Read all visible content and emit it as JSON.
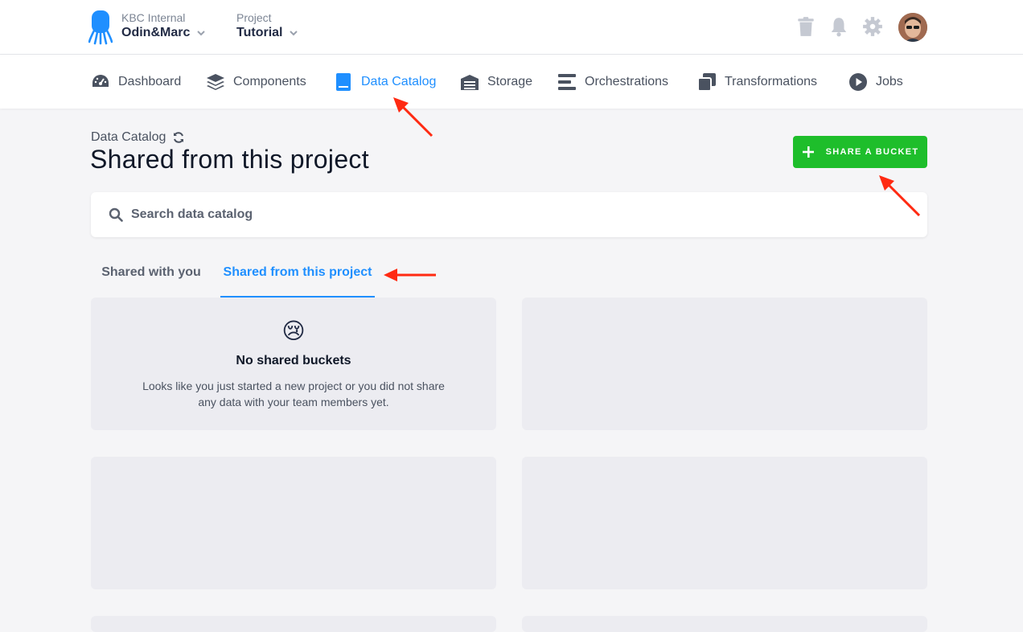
{
  "topbar": {
    "org_label": "KBC Internal",
    "org_name": "Odin&Marc",
    "project_label": "Project",
    "project_name": "Tutorial",
    "icons": [
      "logo-icon",
      "trash-icon",
      "bell-icon",
      "gear-icon",
      "avatar"
    ]
  },
  "nav": {
    "items": [
      {
        "label": "Dashboard",
        "icon": "dashboard-icon"
      },
      {
        "label": "Components",
        "icon": "layers-icon"
      },
      {
        "label": "Data Catalog",
        "icon": "book-icon",
        "active": true
      },
      {
        "label": "Storage",
        "icon": "warehouse-icon"
      },
      {
        "label": "Orchestrations",
        "icon": "bars-icon"
      },
      {
        "label": "Transformations",
        "icon": "copy-icon"
      },
      {
        "label": "Jobs",
        "icon": "play-icon"
      }
    ]
  },
  "page": {
    "breadcrumb": "Data Catalog",
    "title": "Shared from this project",
    "share_button": "SHARE A BUCKET"
  },
  "search": {
    "placeholder": "Search data catalog",
    "value": ""
  },
  "tabs": [
    {
      "label": "Shared with you",
      "active": false
    },
    {
      "label": "Shared from this project",
      "active": true
    }
  ],
  "empty_state": {
    "emoji": "😢",
    "title": "No shared buckets",
    "text": "Looks like you just started a new project or you did not share any data with your team members yet."
  },
  "colors": {
    "accent": "#1f8fff",
    "success": "#1ebe2b",
    "annotation_arrow": "#ff2a12"
  }
}
